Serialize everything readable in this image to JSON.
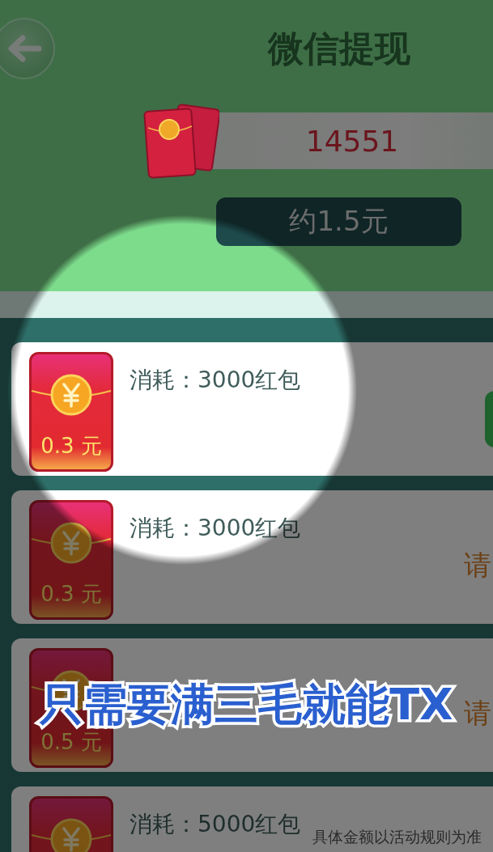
{
  "header": {
    "title": "微信提现",
    "balance": "14551",
    "approx": "约1.5元"
  },
  "rows": [
    {
      "amount": "0.3 元",
      "cost": "消耗：3000红包",
      "button": true
    },
    {
      "amount": "0.3 元",
      "cost": "消耗：3000红包",
      "action": "请"
    },
    {
      "amount": "0.5 元",
      "action": "请"
    },
    {
      "cost": "消耗：5000红包",
      "note": "具体金额以活动规则为准"
    }
  ],
  "caption": "只需要满三毛就能TX"
}
